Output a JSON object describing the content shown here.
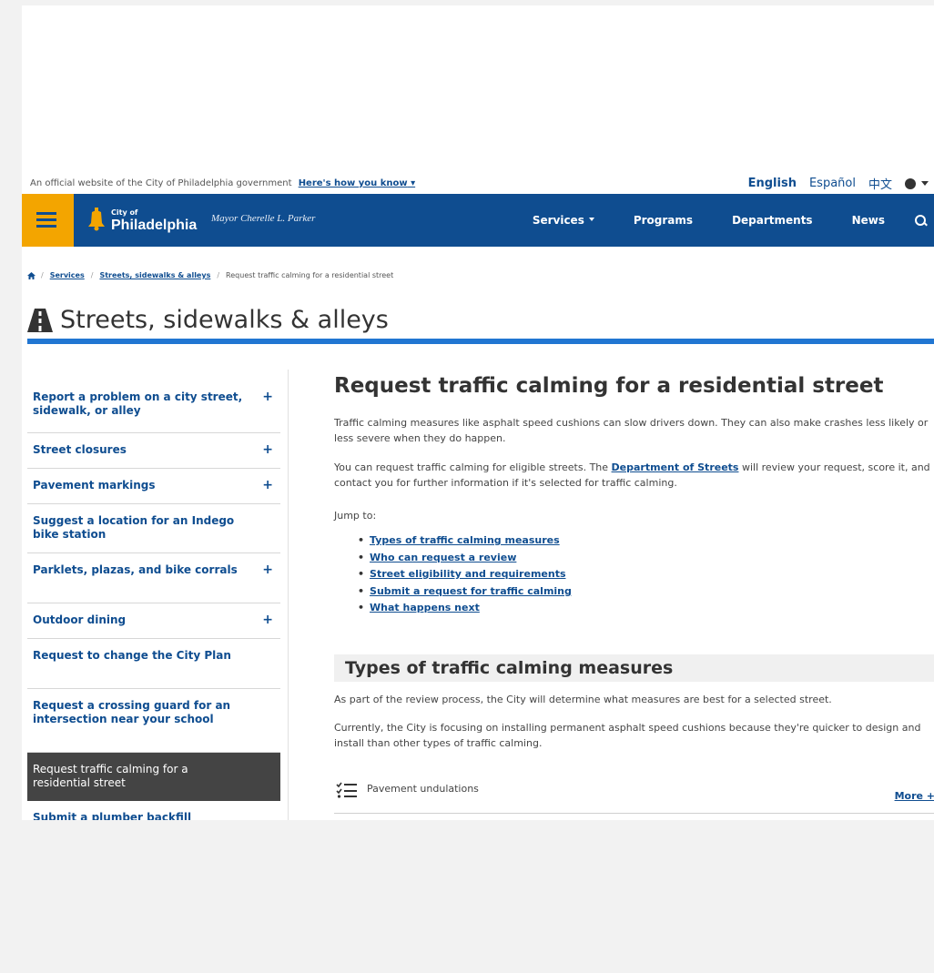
{
  "official_bar": {
    "text": "An official website of the City of Philadelphia government",
    "how_link": "Here's how you know",
    "languages": [
      "English",
      "Español",
      "中文"
    ]
  },
  "header": {
    "logo_small": "City of",
    "logo_main": "Philadelphia",
    "mayor": "Mayor Cherelle L. Parker",
    "nav": [
      "Services",
      "Programs",
      "Departments",
      "News"
    ]
  },
  "breadcrumb": {
    "items": [
      "Services",
      "Streets, sidewalks & alleys"
    ],
    "current": "Request traffic calming for a residential street"
  },
  "section_title": "Streets, sidewalks & alleys",
  "sidebar": {
    "items": [
      {
        "label": "Report a problem on a city street, sidewalk, or alley",
        "expandable": "+"
      },
      {
        "label": "Street closures",
        "expandable": "+"
      },
      {
        "label": "Pavement markings",
        "expandable": "+"
      },
      {
        "label": "Suggest a location for an Indego bike station",
        "expandable": ""
      },
      {
        "label": "Parklets, plazas, and bike corrals",
        "expandable": "+"
      },
      {
        "label": "Outdoor dining",
        "expandable": "+"
      },
      {
        "label": "Request to change the City Plan",
        "expandable": ""
      },
      {
        "label": "Request a crossing guard for an intersection near your school",
        "expandable": ""
      },
      {
        "label": "Request traffic calming for a residential street",
        "expandable": ""
      },
      {
        "label": "Submit a plumber backfill",
        "expandable": ""
      }
    ]
  },
  "main": {
    "title": "Request traffic calming for a residential street",
    "p1": "Traffic calming measures like asphalt speed cushions can slow drivers down. They can also make crashes less likely or less severe when they do happen.",
    "p2_before": "You can request traffic calming for eligible streets. The ",
    "p2_link": "Department of Streets",
    "p2_after": " will review your request, score it, and contact you for further information if it's selected for traffic calming.",
    "jump_label": "Jump to:",
    "jump_links": [
      "Types of traffic calming measures",
      "Who can request a review",
      "Street eligibility and requirements",
      "Submit a request for traffic calming",
      "What happens next"
    ],
    "h2": "Types of traffic calming measures",
    "p4": "As part of the review process, the City will determine what measures are best for a selected street.",
    "p5": "Currently, the City is focusing on installing permanent asphalt speed cushions because they're quicker to design and install than other types of traffic calming.",
    "accordion_label": "Pavement undulations",
    "accordion_more": "More +"
  },
  "colors": {
    "brand_blue": "#0f4d90",
    "accent_orange": "#f3a500",
    "rule_blue": "#2176d2",
    "active_item": "#444444"
  }
}
